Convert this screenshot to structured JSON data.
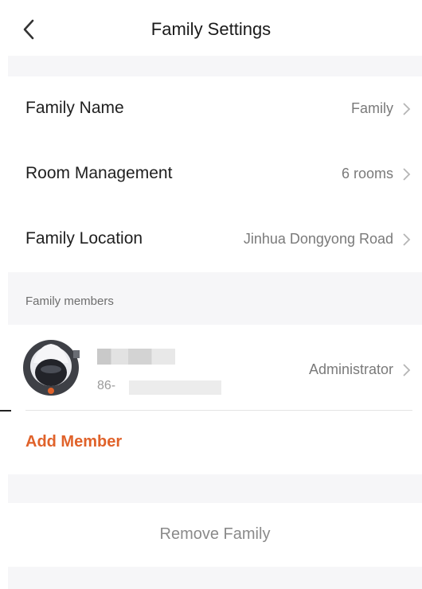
{
  "header": {
    "title": "Family Settings"
  },
  "settings": [
    {
      "label": "Family Name",
      "value": "Family"
    },
    {
      "label": "Room Management",
      "value": "6 rooms"
    },
    {
      "label": "Family Location",
      "value": "Jinhua Dongyong Road"
    }
  ],
  "members": {
    "section_label": "Family members",
    "items": [
      {
        "phone_prefix": "86-",
        "role": "Administrator"
      }
    ],
    "add_label": "Add Member"
  },
  "remove_label": "Remove Family",
  "colors": {
    "accent": "#e0622a",
    "background_gap": "#f6f6f8",
    "muted_text": "#7a7a7a"
  },
  "icons": {
    "back": "chevron-left-icon",
    "row": "chevron-right-icon",
    "avatar": "astronaut-avatar"
  }
}
